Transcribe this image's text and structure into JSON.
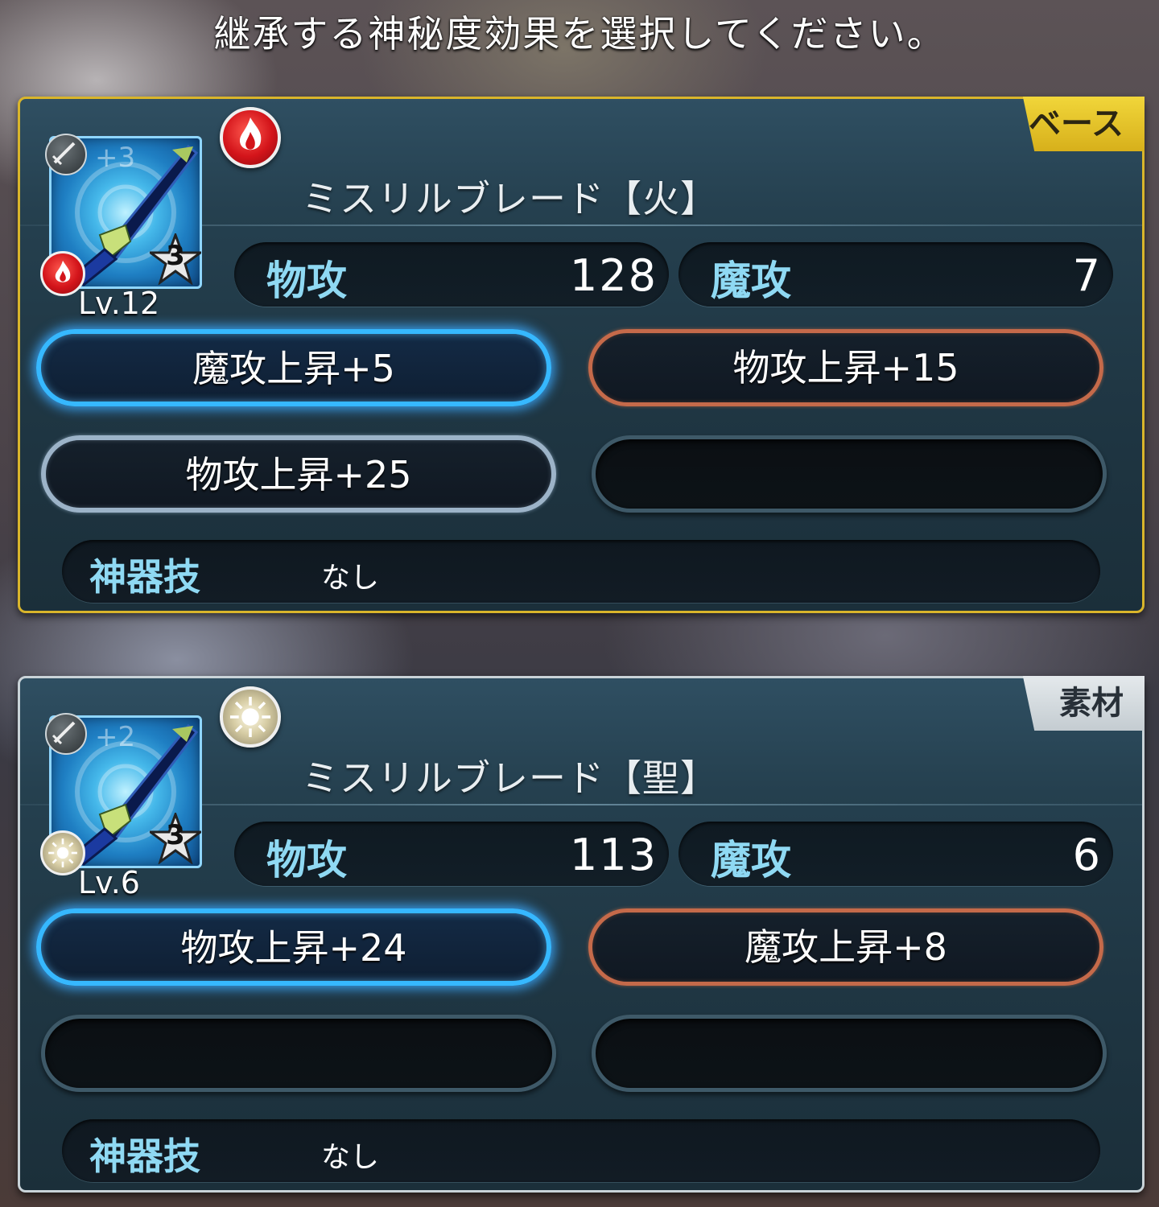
{
  "prompt": "継承する神秘度効果を選択してください。",
  "panels": [
    {
      "tag": "ベース",
      "plus": "+3",
      "stars": "3",
      "level": "Lv.12",
      "element": "fire-icon",
      "name": "ミスリルブレード【火】",
      "stats": {
        "phys_label": "物攻",
        "phys_value": "128",
        "mag_label": "魔攻",
        "mag_value": "7"
      },
      "effects": [
        "魔攻上昇+5",
        "物攻上昇+15",
        "物攻上昇+25",
        ""
      ],
      "skill_label": "神器技",
      "skill_value": "なし"
    },
    {
      "tag": "素材",
      "plus": "+2",
      "stars": "3",
      "level": "Lv.6",
      "element": "holy-icon",
      "name": "ミスリルブレード【聖】",
      "stats": {
        "phys_label": "物攻",
        "phys_value": "113",
        "mag_label": "魔攻",
        "mag_value": "6"
      },
      "effects": [
        "物攻上昇+24",
        "魔攻上昇+8",
        "",
        ""
      ],
      "skill_label": "神器技",
      "skill_value": "なし"
    }
  ],
  "colors": {
    "base_tag": "#d9b52b",
    "material_tag": "#c9d3d8",
    "selected_glow": "#36b8ff",
    "orange_slot": "#c56a4a",
    "label_cyan": "#8fd9f3"
  }
}
